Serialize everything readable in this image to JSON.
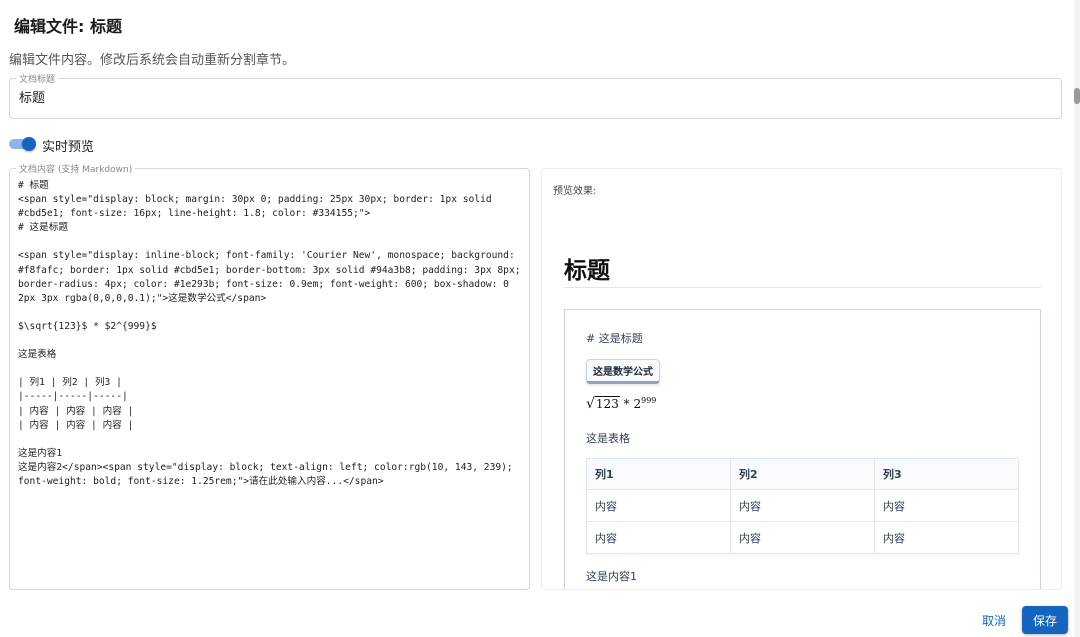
{
  "dialog": {
    "title": "编辑文件: 标题",
    "description": "编辑文件内容。修改后系统会自动重新分割章节。"
  },
  "title_field": {
    "label": "文档标题",
    "value": "标题"
  },
  "live_preview": {
    "label": "实时预览",
    "enabled": true
  },
  "editor": {
    "label": "文档内容 (支持 Markdown)",
    "content": "# 标题\n<span style=\"display: block; margin: 30px 0; padding: 25px 30px; border: 1px solid #cbd5e1; font-size: 16px; line-height: 1.8; color: #334155;\">\n# 这是标题\n\n<span style=\"display: inline-block; font-family: 'Courier New', monospace; background: #f8fafc; border: 1px solid #cbd5e1; border-bottom: 3px solid #94a3b8; padding: 3px 8px; border-radius: 4px; color: #1e293b; font-size: 0.9em; font-weight: 600; box-shadow: 0 2px 3px rgba(0,0,0,0.1);\">这是数学公式</span>\n\n$\\sqrt{123}$ * $2^{999}$\n\n这是表格\n\n| 列1 | 列2 | 列3 |\n|-----|-----|-----|\n| 内容 | 内容 | 内容 |\n| 内容 | 内容 | 内容 |\n\n这是内容1\n这是内容2</span><span style=\"display: block; text-align: left; color:rgb(10, 143, 239); font-weight: bold; font-size: 1.25rem;\">请在此处输入内容...</span>"
  },
  "preview": {
    "label": "预览效果:",
    "heading": "标题",
    "block_heading": "# 这是标题",
    "math_badge": "这是数学公式",
    "math": {
      "sqrt_arg": "123",
      "operator": "*",
      "base": "2",
      "exponent": "999"
    },
    "table_caption": "这是表格",
    "table": {
      "headers": [
        "列1",
        "列2",
        "列3"
      ],
      "rows": [
        [
          "内容",
          "内容",
          "内容"
        ],
        [
          "内容",
          "内容",
          "内容"
        ]
      ]
    },
    "content_line": "这是内容1"
  },
  "actions": {
    "cancel_label": "取消",
    "save_label": "保存"
  },
  "colors": {
    "primary": "#1565c0",
    "block_border": "#cbd5e1",
    "text": "#334155"
  }
}
